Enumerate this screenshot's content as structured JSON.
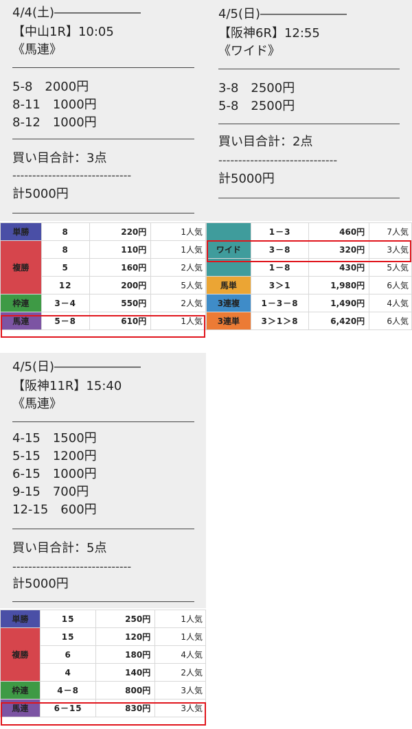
{
  "panel1": {
    "date": "4/4(土)―――――――",
    "race": "【中山1R】10:05",
    "bet_type": "《馬連》",
    "bets": [
      "5-8　2000円",
      "8-11　1000円",
      "8-12　1000円"
    ],
    "total_points": "買い目合計：3点",
    "dashes": "------------------------------",
    "total_amount": "計5000円"
  },
  "panel2": {
    "date": "4/5(日)―――――――",
    "race": "【阪神6R】12:55",
    "bet_type": "《ワイド》",
    "bets": [
      "3-8　2500円",
      "5-8　2500円"
    ],
    "total_points": "買い目合計：2点",
    "dashes": "------------------------------",
    "total_amount": "計5000円"
  },
  "panel3": {
    "date": "4/5(日)―――――――",
    "race": "【阪神11R】15:40",
    "bet_type": "《馬連》",
    "bets": [
      "4-15　1500円",
      "5-15　1200円",
      "6-15　1000円",
      "9-15　700円",
      "12-15　600円"
    ],
    "total_points": "買い目合計：5点",
    "dashes": "------------------------------",
    "total_amount": "計5000円"
  },
  "table1": {
    "win": {
      "label": "単勝",
      "comb": "8",
      "pay": "220円",
      "pop": "1人気"
    },
    "place": {
      "label": "複勝",
      "rows": [
        {
          "comb": "8",
          "pay": "110円",
          "pop": "1人気"
        },
        {
          "comb": "5",
          "pay": "160円",
          "pop": "2人気"
        },
        {
          "comb": "12",
          "pay": "200円",
          "pop": "5人気"
        }
      ]
    },
    "waku": {
      "label": "枠連",
      "comb": "3－4",
      "pay": "550円",
      "pop": "2人気"
    },
    "umaren": {
      "label": "馬連",
      "comb": "5－8",
      "pay": "610円",
      "pop": "1人気"
    }
  },
  "table2": {
    "wide": {
      "label": "ワイド",
      "rows": [
        {
          "comb": "1－3",
          "pay": "460円",
          "pop": "7人気"
        },
        {
          "comb": "3－8",
          "pay": "320円",
          "pop": "3人気"
        },
        {
          "comb": "1－8",
          "pay": "430円",
          "pop": "5人気"
        }
      ]
    },
    "umatan": {
      "label": "馬単",
      "comb": "3＞1",
      "pay": "1,980円",
      "pop": "6人気"
    },
    "sanrenpuku": {
      "label": "3連複",
      "comb": "1－3－8",
      "pay": "1,490円",
      "pop": "4人気"
    },
    "sanrentan": {
      "label": "3連単",
      "comb": "3＞1＞8",
      "pay": "6,420円",
      "pop": "6人気"
    }
  },
  "table3": {
    "win": {
      "label": "単勝",
      "comb": "15",
      "pay": "250円",
      "pop": "1人気"
    },
    "place": {
      "label": "複勝",
      "rows": [
        {
          "comb": "15",
          "pay": "120円",
          "pop": "1人気"
        },
        {
          "comb": "6",
          "pay": "180円",
          "pop": "4人気"
        },
        {
          "comb": "4",
          "pay": "140円",
          "pop": "2人気"
        }
      ]
    },
    "waku": {
      "label": "枠連",
      "comb": "4－8",
      "pay": "800円",
      "pop": "3人気"
    },
    "umaren": {
      "label": "馬連",
      "comb": "6－15",
      "pay": "830円",
      "pop": "3人気"
    }
  },
  "colors": {
    "win": "#4a4fa6",
    "place": "#d6454c",
    "waku": "#3e9a45",
    "umaren": "#7c54a3",
    "wide": "#3f9c9c",
    "umatan": "#eba534",
    "sanrenpuku": "#3f8cc8",
    "sanrentan": "#ec7b35",
    "highlight": "#e0141b"
  }
}
